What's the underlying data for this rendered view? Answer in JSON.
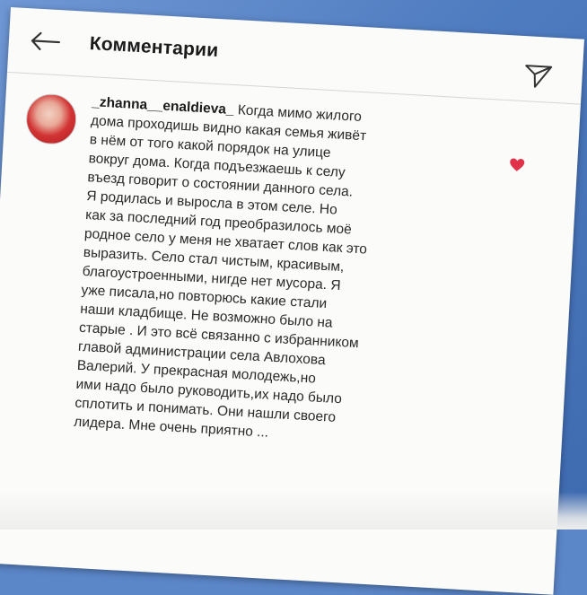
{
  "header": {
    "back_icon": "arrow-left-icon",
    "title": "Комментарии",
    "send_icon": "paper-plane-icon"
  },
  "comment": {
    "avatar_icon": "profile-photo",
    "username": "_zhanna__enaldieva_",
    "lines": [
      " Когда мимо жилого",
      "дома проходишь видно какая семья живёт",
      "в нём от того какой порядок на улице",
      "вокруг дома. Когда подъезжаешь к селу",
      "въезд говорит о состоянии данного села.",
      "Я родилась и выросла в этом селе. Но",
      "как за последний год преобразилось моё",
      "родное село у меня не хватает слов как это",
      "выразить. Село стал чистым, красивым,",
      "благоустроенными, нигде нет мусора. Я",
      "уже писала,но повторюсь какие стали",
      "наши кладбище. Не возможно было на",
      "старые . И это всё связанно с избранником",
      "главой администрации села Авлохова",
      "Валерий. У прекрасная молодежь,но",
      "ими надо было руководить,их надо было",
      "сплотить и понимать. Они нашли своего",
      "лидера. Мне очень приятно ..."
    ],
    "like_icon": "heart-icon",
    "like_color": "#e0334a"
  },
  "colors": {
    "background": "#5b86c8",
    "card": "#fbfbfa",
    "text": "#2a2a2a"
  }
}
